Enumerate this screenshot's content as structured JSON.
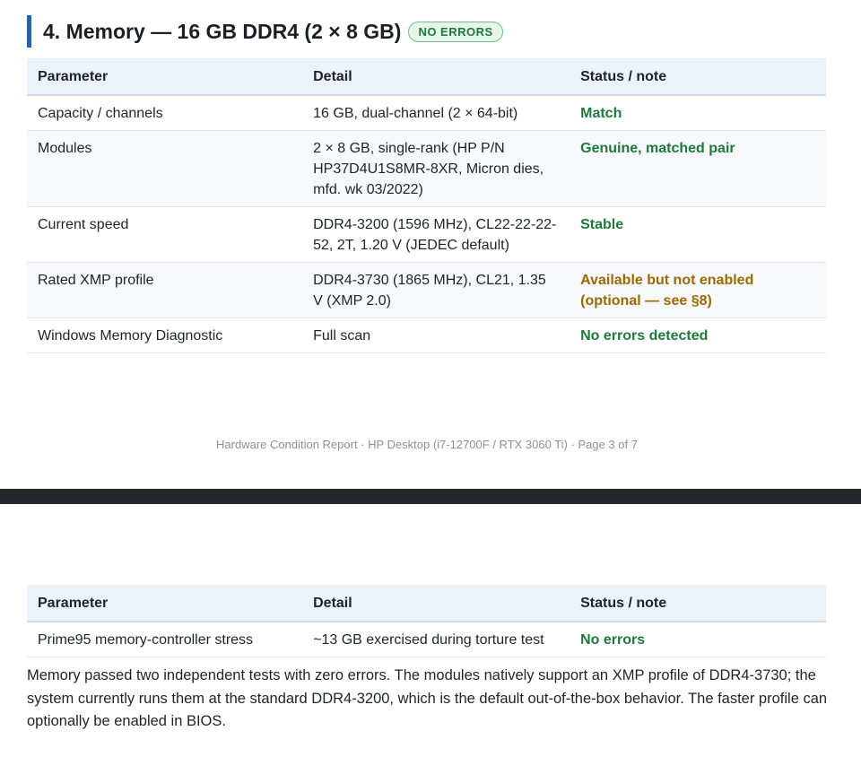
{
  "section": {
    "title": "4. Memory — 16 GB DDR4 (2 × 8 GB)",
    "badge": "NO ERRORS"
  },
  "table_headers": {
    "parameter": "Parameter",
    "detail": "Detail",
    "status": "Status / note"
  },
  "rows": [
    {
      "parameter": "Capacity / channels",
      "detail": "16 GB, dual-channel (2 × 64-bit)",
      "status": "Match",
      "status_kind": "ok"
    },
    {
      "parameter": "Modules",
      "detail": "2 × 8 GB, single-rank (HP P/N HP37D4U1S8MR-8XR, Micron dies, mfd. wk 03/2022)",
      "status": "Genuine, matched pair",
      "status_kind": "ok"
    },
    {
      "parameter": "Current speed",
      "detail": "DDR4-3200 (1596 MHz), CL22-22-22-52, 2T, 1.20 V (JEDEC default)",
      "status": "Stable",
      "status_kind": "ok"
    },
    {
      "parameter": "Rated XMP profile",
      "detail": "DDR4-3730 (1865 MHz), CL21, 1.35 V (XMP 2.0)",
      "status": "Available but not enabled (optional — see §8)",
      "status_kind": "warn"
    },
    {
      "parameter": "Windows Memory Diagnostic",
      "detail": "Full scan",
      "status": "No errors detected",
      "status_kind": "ok"
    }
  ],
  "footer": "Hardware Condition Report · HP Desktop (i7-12700F / RTX 3060 Ti) · Page 3 of 7",
  "rows_continued": [
    {
      "parameter": "Prime95 memory-controller stress",
      "detail": "~13 GB exercised during torture test",
      "status": "No errors",
      "status_kind": "ok"
    }
  ],
  "summary": "Memory passed two independent tests with zero errors. The modules natively support an XMP profile of DDR4-3730; the system currently runs them at the standard DDR4-3200, which is the default out-of-the-box behavior. The faster profile can optionally be enabled in BIOS.",
  "colors": {
    "accent": "#2b5fa8",
    "status_ok": "#1e7a3c",
    "status_warn": "#9a6a00",
    "header_bg": "#edf2f9",
    "page_break": "#24272b"
  }
}
